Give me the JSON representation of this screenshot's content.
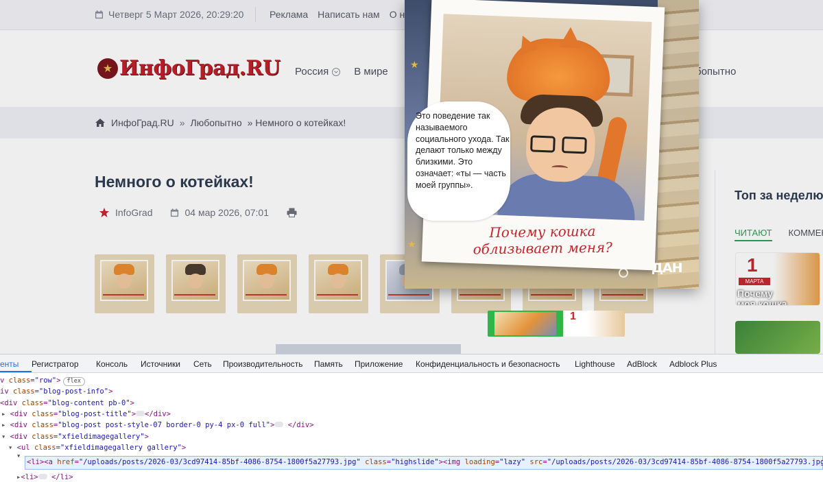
{
  "topbar": {
    "date": "Четверг 5 Март 2026, 20:29:20",
    "links": [
      "Реклама",
      "Написать нам",
      "О на"
    ]
  },
  "header": {
    "logo_text": "ИнфоГрад.RU",
    "nav": [
      "Россия",
      "В мире"
    ],
    "nav_right": "бопытно"
  },
  "breadcrumb": {
    "home": "ИнфоГрад.RU",
    "sep": "»",
    "section": "Любопытно",
    "current": "» Немного о котейках!"
  },
  "article": {
    "title": "Немного о котейках!",
    "author": "InfoGrad",
    "date": "04 мар 2026, 07:01",
    "thumb_count": 8
  },
  "sidebar": {
    "heading": "Топ за неделю",
    "tab_active": "ЧИТАЮТ",
    "tab_other": "КОММЕНТ",
    "card_day": "1",
    "card_month": "МАРТА",
    "card_caption_1": "Почему",
    "card_caption_2": "моя кошка"
  },
  "lightbox": {
    "bubble_text": "Это поведение так называемого социального ухода. Так делают только между близкими. Это означает: «ты — часть моей группы».",
    "caption_line1": "Почему кошка",
    "caption_line2": "облизывает меня?",
    "brand": "ДАН",
    "film_day": "1"
  },
  "devtools": {
    "tabs": [
      "енты",
      "Регистратор",
      "Консоль",
      "Источники",
      "Сеть",
      "Производительность",
      "Память",
      "Приложение",
      "Конфиденциальность и безопасность",
      "Lighthouse",
      "AdBlock",
      "Adblock Plus"
    ],
    "active_tab": 0,
    "badge_flex": "flex",
    "lines": {
      "l1_tag": "v",
      "l1_class": "class",
      "l1_val": "\"row\"",
      "l2_val": "\"blog-post-info\"",
      "l3_val": "\"blog-content pb-0\"",
      "l4_val": "\"blog-post-title\"",
      "l5_val": "\"blog-post post-style-07 border-0 py-4 px-0 full\"",
      "l6_val": "\"xfieldimagegallery\"",
      "l7_val": "\"xfieldimagegallery gallery\"",
      "l8_href": "\"/uploads/posts/2026-03/3cd97414-85bf-4086-8754-1800f5a27793.jpg\"",
      "l8_class": "\"highslide\"",
      "l8_loading": "\"lazy\"",
      "l8_src": "\"/uploads/posts/2026-03/3cd97414-85bf-4086-8754-1800f5a27793.jpg\""
    }
  },
  "colors": {
    "brand_red": "#c21e25",
    "accent_green": "#2e9d52",
    "devtools_blue": "#1a73e8"
  }
}
